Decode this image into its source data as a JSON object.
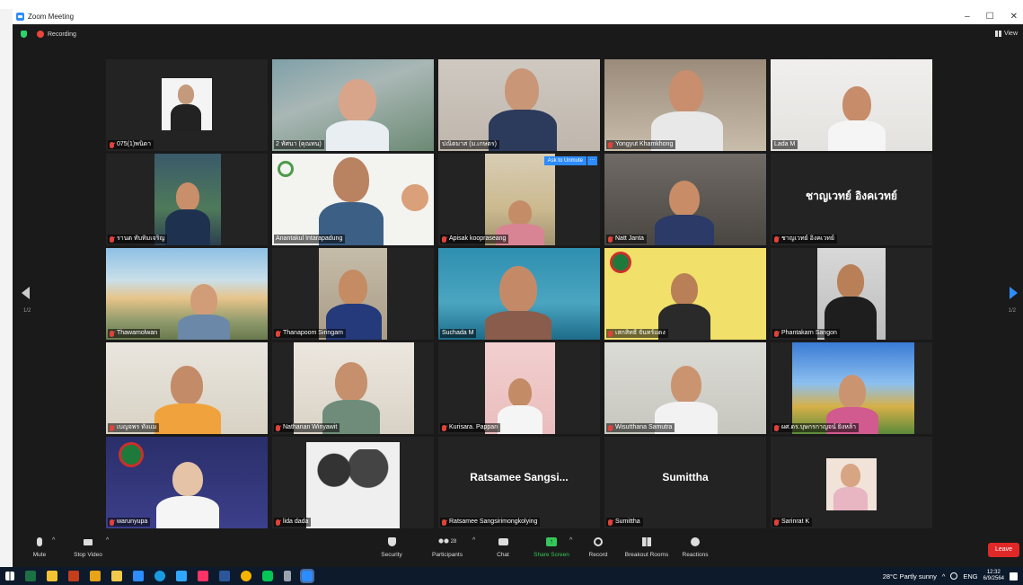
{
  "window": {
    "title": "Zoom Meeting",
    "minimize": "–",
    "maximize": "☐",
    "close": "✕"
  },
  "topbar": {
    "recording": "Recording",
    "view": "View"
  },
  "pagination": {
    "left": "1/2",
    "right": "1/2"
  },
  "tiles": [
    {
      "name": "075(1)พนิดา",
      "muted": true
    },
    {
      "name": "2 ทัศนา (คุณทน)",
      "muted": false
    },
    {
      "name": "ปณิตมาส (ม.เกษตร)",
      "muted": false
    },
    {
      "name": "Yongyut Khamkhong",
      "muted": true
    },
    {
      "name": "Lada M",
      "muted": false
    },
    {
      "name": "รานต ทับทิมเจริญ",
      "muted": true
    },
    {
      "name": "Anantakul Intarapadung",
      "muted": false
    },
    {
      "name": "Apisak koopraseang",
      "muted": true,
      "unmute": "Ask to Unmute",
      "more": "···"
    },
    {
      "name": "Natt Janta",
      "muted": true
    },
    {
      "name": "ชาญเวทย์ อิงคเวทย์",
      "muted": true,
      "center": "ชาญเวทย์ อิงคเวทย์"
    },
    {
      "name": "Thawamolwan",
      "muted": true
    },
    {
      "name": "Thanapoom Siringam",
      "muted": true
    },
    {
      "name": "Suchada M",
      "muted": false
    },
    {
      "name": "เสกสิทธิ์ จันทร์แดง",
      "muted": true
    },
    {
      "name": "Phantakarn Sangon",
      "muted": true
    },
    {
      "name": "เบญจพร ทั่งแม",
      "muted": true
    },
    {
      "name": "Nathanan Winyawit",
      "muted": true
    },
    {
      "name": "Kurisara. Pappan",
      "muted": true
    },
    {
      "name": "Wisutthana Samutra",
      "muted": true
    },
    {
      "name": "ผศ.ดร.บุษกรกาญจน์ ยิ่งหล้า",
      "muted": true
    },
    {
      "name": "warunyupa",
      "muted": true
    },
    {
      "name": "lida dada",
      "muted": true
    },
    {
      "name": "Ratsamee Sangsirimongkolying",
      "muted": true,
      "center": "Ratsamee Sangsi..."
    },
    {
      "name": "Sumittha",
      "muted": true,
      "center": "Sumittha"
    },
    {
      "name": "Sarinrat K",
      "muted": true
    }
  ],
  "toolbar": {
    "mute": "Mute",
    "stop_video": "Stop Video",
    "security": "Security",
    "participants": "Participants",
    "participants_count": "28",
    "chat": "Chat",
    "share_screen": "Share Screen",
    "record": "Record",
    "breakout": "Breakout Rooms",
    "reactions": "Reactions",
    "leave": "Leave",
    "caret": "^",
    "share_arrow": "↑"
  },
  "taskbar": {
    "weather": "28°C  Partly sunny",
    "lang": "ENG",
    "time": "12:32",
    "date": "6/9/2564"
  },
  "colors": {
    "accent": "#2d8cff",
    "leave": "#e02828",
    "share": "#34c759",
    "active_border": "#e4d96b"
  }
}
